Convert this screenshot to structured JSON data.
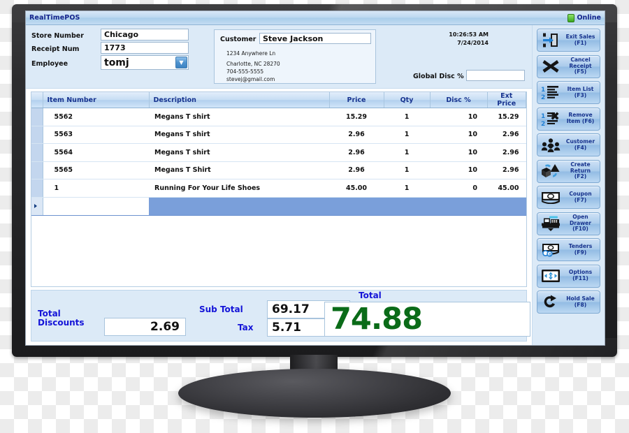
{
  "window": {
    "title": "RealTimePOS",
    "status_label": "Online",
    "status_icon": "online-indicator-icon"
  },
  "info": {
    "store_number_label": "Store Number",
    "store_number_value": "Chicago",
    "receipt_num_label": "Receipt Num",
    "receipt_num_value": "1773",
    "employee_label": "Employee",
    "employee_value": "tomj",
    "customer_label": "Customer",
    "customer_value": "Steve Jackson",
    "customer_address_line1": "1234 Anywhere Ln",
    "customer_address_line2": "Charlotte, NC 28270",
    "customer_phone": "704-555-5555",
    "customer_email": "stevej@gmail.com",
    "time": "10:26:53 AM",
    "date": "7/24/2014",
    "global_disc_label": "Global Disc %",
    "global_disc_value": ""
  },
  "grid": {
    "columns": [
      "Item Number",
      "Description",
      "Price",
      "Qty",
      "Disc %",
      "Ext Price"
    ],
    "rows": [
      {
        "item_number": "5562",
        "description": "Megans T shirt",
        "price": "15.29",
        "qty": "1",
        "disc": "10",
        "ext_price": "15.29"
      },
      {
        "item_number": "5563",
        "description": "Megans T shirt",
        "price": "2.96",
        "qty": "1",
        "disc": "10",
        "ext_price": "2.96"
      },
      {
        "item_number": "5564",
        "description": "Megans T shirt",
        "price": "2.96",
        "qty": "1",
        "disc": "10",
        "ext_price": "2.96"
      },
      {
        "item_number": "5565",
        "description": "Megans T Shirt",
        "price": "2.96",
        "qty": "1",
        "disc": "10",
        "ext_price": "2.96"
      },
      {
        "item_number": "1",
        "description": "Running For Your Life Shoes",
        "price": "45.00",
        "qty": "1",
        "disc": "0",
        "ext_price": "45.00"
      }
    ]
  },
  "totals": {
    "total_discounts_label_line1": "Total",
    "total_discounts_label_line2": "Discounts",
    "total_discounts_value": "2.69",
    "sub_total_label": "Sub Total",
    "sub_total_value": "69.17",
    "tax_label": "Tax",
    "tax_value": "5.71",
    "total_label": "Total",
    "total_value": "74.88",
    "total_color": "#0a6b18"
  },
  "sidebar": {
    "buttons": [
      {
        "line1": "Exit Sales",
        "line2": "(F1)",
        "icon": "exit-door-icon"
      },
      {
        "line1": "Cancel",
        "line2": "Receipt",
        "line3": "(F5)",
        "icon": "x-cross-icon"
      },
      {
        "line1": "Item List",
        "line2": "(F3)",
        "icon": "numbered-list-icon"
      },
      {
        "line1": "Remove",
        "line2": "Item (F6)",
        "icon": "remove-list-item-icon"
      },
      {
        "line1": "Customer",
        "line2": "(F4)",
        "icon": "people-group-icon"
      },
      {
        "line1": "Create",
        "line2": "Return",
        "line3": "(F2)",
        "icon": "return-recycle-icon"
      },
      {
        "line1": "Coupon",
        "line2": "(F7)",
        "icon": "coupon-money-icon"
      },
      {
        "line1": "Open",
        "line2": "Drawer",
        "line3": "(F10)",
        "icon": "cash-register-icon"
      },
      {
        "line1": "Tenders",
        "line2": "(F9)",
        "icon": "cash-coins-icon"
      },
      {
        "line1": "Options",
        "line2": "(F11)",
        "icon": "arrows-screen-icon"
      },
      {
        "line1": "Hold Sale",
        "line2": "(F8)",
        "icon": "hold-arrow-icon"
      }
    ]
  }
}
